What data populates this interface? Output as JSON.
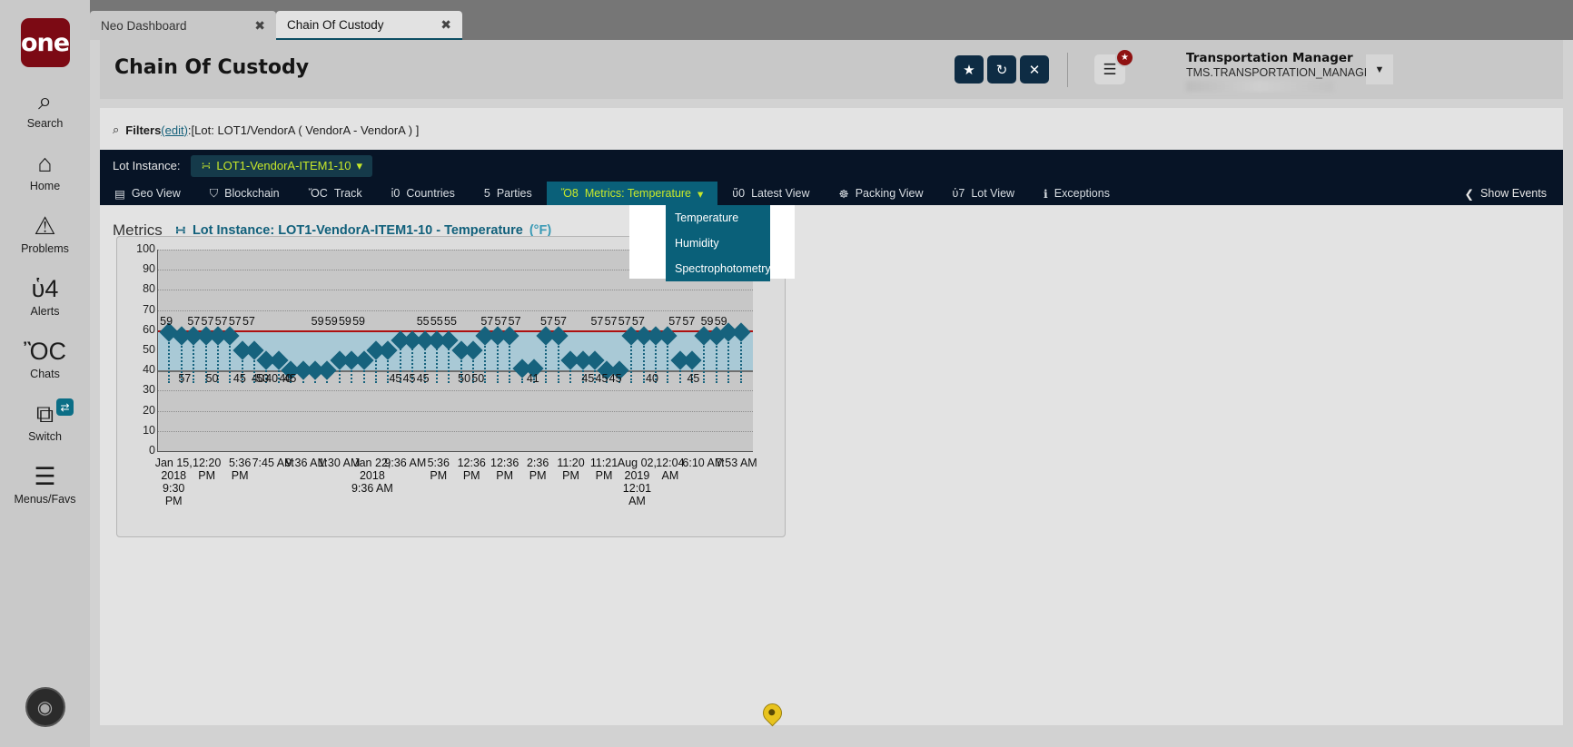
{
  "rail": {
    "logo_text": "one",
    "items": [
      {
        "name": "search",
        "label": "Search",
        "icon": "search-icon",
        "glyph": "⌕"
      },
      {
        "name": "home",
        "label": "Home",
        "icon": "home-icon",
        "glyph": "⌂"
      },
      {
        "name": "problems",
        "label": "Problems",
        "icon": "warning-icon",
        "glyph": "⚠"
      },
      {
        "name": "alerts",
        "label": "Alerts",
        "icon": "bell-icon",
        "glyph": "ὑ4"
      },
      {
        "name": "chats",
        "label": "Chats",
        "icon": "chat-icon",
        "glyph": "ὊC"
      },
      {
        "name": "switch",
        "label": "Switch",
        "icon": "switch-icon",
        "glyph": "⧉",
        "badge": "⇄"
      },
      {
        "name": "menus-favs",
        "label": "Menus/Favs",
        "icon": "hamburger-icon",
        "glyph": "☰"
      }
    ]
  },
  "browser_tabs": [
    {
      "label": "Neo Dashboard",
      "active": false,
      "close": "✖"
    },
    {
      "label": "Chain Of Custody",
      "active": true,
      "close": "✖"
    }
  ],
  "header": {
    "title": "Chain Of Custody",
    "buttons": [
      {
        "name": "favorite-button",
        "icon": "star-icon",
        "glyph": "★"
      },
      {
        "name": "refresh-button",
        "icon": "refresh-icon",
        "glyph": "↻"
      },
      {
        "name": "close-button",
        "icon": "close-icon",
        "glyph": "✕"
      }
    ],
    "menu_icon": "☰",
    "menu_badge": "★",
    "user_name": "Transportation Manager",
    "user_role": "TMS.TRANSPORTATION_MANAGER",
    "caret": "▼"
  },
  "filters": {
    "icon": "⌕",
    "label": "Filters",
    "edit": "(edit)",
    "value": ":[Lot: LOT1/VendorA ( VendorA - VendorA ) ]"
  },
  "lot_bar": {
    "label": "Lot Instance:",
    "chip": "LOT1-VendorA-ITEM1-10",
    "chip_icon": "share-icon",
    "caret": "▾"
  },
  "nav_tabs": [
    {
      "label": "Geo View",
      "icon": "map-icon",
      "glyph": "▤",
      "selected": false
    },
    {
      "label": "Blockchain",
      "icon": "shield-icon",
      "glyph": "⛉",
      "selected": false
    },
    {
      "label": "Track",
      "icon": "pin-icon",
      "glyph": "ὌC",
      "selected": false
    },
    {
      "label": "Countries",
      "icon": "globe-icon",
      "glyph": "ἱ0",
      "selected": false
    },
    {
      "label": "Parties",
      "icon": "people-icon",
      "glyph": "὆5",
      "selected": false
    },
    {
      "label": "Metrics: Temperature",
      "icon": "chart-icon",
      "glyph": "Ὄ8",
      "selected": true,
      "caret": "▾"
    },
    {
      "label": "Latest View",
      "icon": "clock-icon",
      "glyph": "ὕ0",
      "selected": false
    },
    {
      "label": "Packing View",
      "icon": "package-icon",
      "glyph": "☸",
      "selected": false
    },
    {
      "label": "Lot View",
      "icon": "share-icon",
      "glyph": "ὑ7",
      "selected": false
    },
    {
      "label": "Exceptions",
      "icon": "info-icon",
      "glyph": "ℹ",
      "selected": false
    }
  ],
  "show_events": {
    "label": "Show Events",
    "caret": "❮"
  },
  "dropdown": {
    "open": true,
    "items": [
      "Temperature",
      "Humidity",
      "Spectrophotometry"
    ]
  },
  "metrics": {
    "section_label": "Metrics",
    "title": "Lot Instance: LOT1-VendorA-ITEM1-10 - Temperature",
    "unit": "(°F)",
    "icon": "share-icon"
  },
  "colors": {
    "accent": "#0a6079",
    "brand_red": "#7c0a14",
    "nav_dark": "#071426",
    "yellow_green": "#c8e82a",
    "marker": "#16627d",
    "band": "#a9c9d6",
    "upper_limit": "#ad1111",
    "lower_limit": "#6f6f6f"
  },
  "chart_data": {
    "type": "scatter",
    "title": "Lot Instance: LOT1-VendorA-ITEM1-10 - Temperature (°F)",
    "xlabel": "",
    "ylabel": "",
    "ylim": [
      0,
      100
    ],
    "yticks": [
      0,
      10,
      20,
      30,
      40,
      50,
      60,
      70,
      80,
      90,
      100
    ],
    "grid": true,
    "upper_limit": 60,
    "lower_limit": 40,
    "legend_position": "none",
    "xtick_labels": [
      "Jan 15, 2018 9:30 PM",
      "12:20 PM",
      "5:36 PM",
      "7:45 AM",
      "9:36 AM",
      "1:30 AM",
      "Jan 22, 2018 9:36 AM",
      "9:36 AM",
      "5:36 PM",
      "12:36 PM",
      "12:36 PM",
      "2:36 PM",
      "11:20 PM",
      "11:21 PM",
      "Aug 02, 2019 12:01 AM",
      "12:04 AM",
      "6:10 AM",
      "7:53 AM"
    ],
    "values": [
      59,
      57,
      57,
      57,
      57,
      57,
      50,
      50,
      45,
      45,
      40,
      40,
      40,
      40,
      45,
      45,
      45,
      50,
      50,
      55,
      55,
      55,
      55,
      55,
      50,
      50,
      57,
      57,
      57,
      41,
      41,
      57,
      57,
      45,
      45,
      45,
      40,
      40,
      57,
      57,
      57,
      57,
      45,
      45,
      57,
      57,
      59,
      59
    ],
    "upper_series_labels": [
      {
        "text": "59",
        "x": 2
      },
      {
        "text": "57",
        "x": 8
      },
      {
        "text": "57",
        "x": 11
      },
      {
        "text": "57",
        "x": 14
      },
      {
        "text": "57",
        "x": 17
      },
      {
        "text": "57",
        "x": 20
      },
      {
        "text": "59",
        "x": 35
      },
      {
        "text": "59",
        "x": 38
      },
      {
        "text": "59",
        "x": 41
      },
      {
        "text": "59",
        "x": 44
      },
      {
        "text": "55",
        "x": 58
      },
      {
        "text": "55",
        "x": 61
      },
      {
        "text": "55",
        "x": 64
      },
      {
        "text": "57",
        "x": 72
      },
      {
        "text": "57",
        "x": 75
      },
      {
        "text": "57",
        "x": 78
      },
      {
        "text": "57",
        "x": 85
      },
      {
        "text": "57",
        "x": 88
      },
      {
        "text": "57",
        "x": 96
      },
      {
        "text": "57",
        "x": 99
      },
      {
        "text": "57",
        "x": 102
      },
      {
        "text": "57",
        "x": 105
      },
      {
        "text": "57",
        "x": 113
      },
      {
        "text": "57",
        "x": 116
      },
      {
        "text": "59",
        "x": 120
      },
      {
        "text": "59",
        "x": 123
      }
    ],
    "lower_series_labels": [
      {
        "text": "57",
        "x": 6
      },
      {
        "text": "50",
        "x": 23
      },
      {
        "text": "45",
        "x": 29
      },
      {
        "text": "50",
        "x": 12
      },
      {
        "text": "45",
        "x": 18
      },
      {
        "text": "40",
        "x": 22
      },
      {
        "text": "40",
        "x": 25
      },
      {
        "text": "40",
        "x": 28
      },
      {
        "text": "45",
        "x": 52
      },
      {
        "text": "45",
        "x": 55
      },
      {
        "text": "45",
        "x": 58
      },
      {
        "text": "50",
        "x": 67
      },
      {
        "text": "50",
        "x": 70
      },
      {
        "text": "41",
        "x": 82
      },
      {
        "text": "45",
        "x": 94
      },
      {
        "text": "45",
        "x": 97
      },
      {
        "text": "45",
        "x": 100
      },
      {
        "text": "40",
        "x": 108
      },
      {
        "text": "45",
        "x": 117
      }
    ]
  }
}
